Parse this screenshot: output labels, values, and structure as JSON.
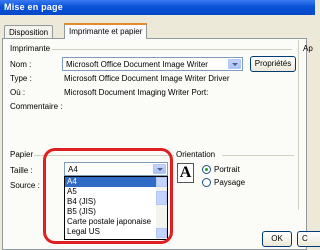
{
  "window": {
    "title": "Mise en page"
  },
  "tabs": [
    {
      "label": "Disposition"
    },
    {
      "label": "Imprimante et papier"
    }
  ],
  "printer": {
    "group_label": "Imprimante",
    "name_label": "Nom :",
    "name_value": "Microsoft Office Document Image Writer",
    "properties_button": "Propriétés",
    "type_label": "Type :",
    "type_value": "Microsoft Office Document Image Writer Driver",
    "where_label": "Où :",
    "where_value": "Microsoft Document Imaging Writer Port:",
    "comment_label": "Commentaire :"
  },
  "right_group": {
    "label": "Ap"
  },
  "paper": {
    "group_label": "Papier",
    "size_label": "Taille :",
    "size_value": "A4",
    "source_label": "Source :",
    "options": [
      "A4",
      "A5",
      "B4 (JIS)",
      "B5 (JIS)",
      "Carte postale japonaise",
      "Legal US"
    ]
  },
  "orientation": {
    "group_label": "Orientation",
    "icon_letter": "A",
    "portrait": "Portrait",
    "landscape": "Paysage"
  },
  "footer": {
    "ok": "OK",
    "cancel": "C"
  }
}
